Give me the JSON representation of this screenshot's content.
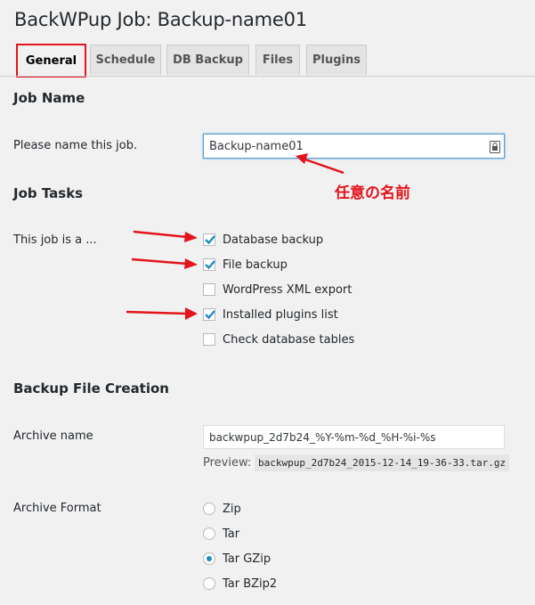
{
  "page": {
    "title": "BackWPup Job: Backup-name01"
  },
  "tabs": [
    {
      "label": "General",
      "active": true
    },
    {
      "label": "Schedule",
      "active": false
    },
    {
      "label": "DB Backup",
      "active": false
    },
    {
      "label": "Files",
      "active": false
    },
    {
      "label": "Plugins",
      "active": false
    }
  ],
  "job_name": {
    "section_title": "Job Name",
    "label": "Please name this job.",
    "value": "Backup-name01"
  },
  "job_tasks": {
    "section_title": "Job Tasks",
    "label": "This job is a ...",
    "options": [
      {
        "label": "Database backup",
        "checked": true
      },
      {
        "label": "File backup",
        "checked": true
      },
      {
        "label": "WordPress XML export",
        "checked": false
      },
      {
        "label": "Installed plugins list",
        "checked": true
      },
      {
        "label": "Check database tables",
        "checked": false
      }
    ]
  },
  "backup_file": {
    "section_title": "Backup File Creation",
    "archive_name_label": "Archive name",
    "archive_name_value": "backwpup_2d7b24_%Y-%m-%d_%H-%i-%s",
    "preview_label": "Preview:",
    "preview_value": "backwpup_2d7b24_2015-12-14_19-36-33.tar.gz",
    "archive_format_label": "Archive Format",
    "formats": [
      {
        "label": "Zip",
        "checked": false
      },
      {
        "label": "Tar",
        "checked": false
      },
      {
        "label": "Tar GZip",
        "checked": true
      },
      {
        "label": "Tar BZip2",
        "checked": false
      }
    ]
  },
  "annotation": {
    "text": "任意の名前",
    "color": "#e3141c"
  },
  "colors": {
    "accent": "#1e8cbe",
    "highlight": "#e3141c"
  }
}
